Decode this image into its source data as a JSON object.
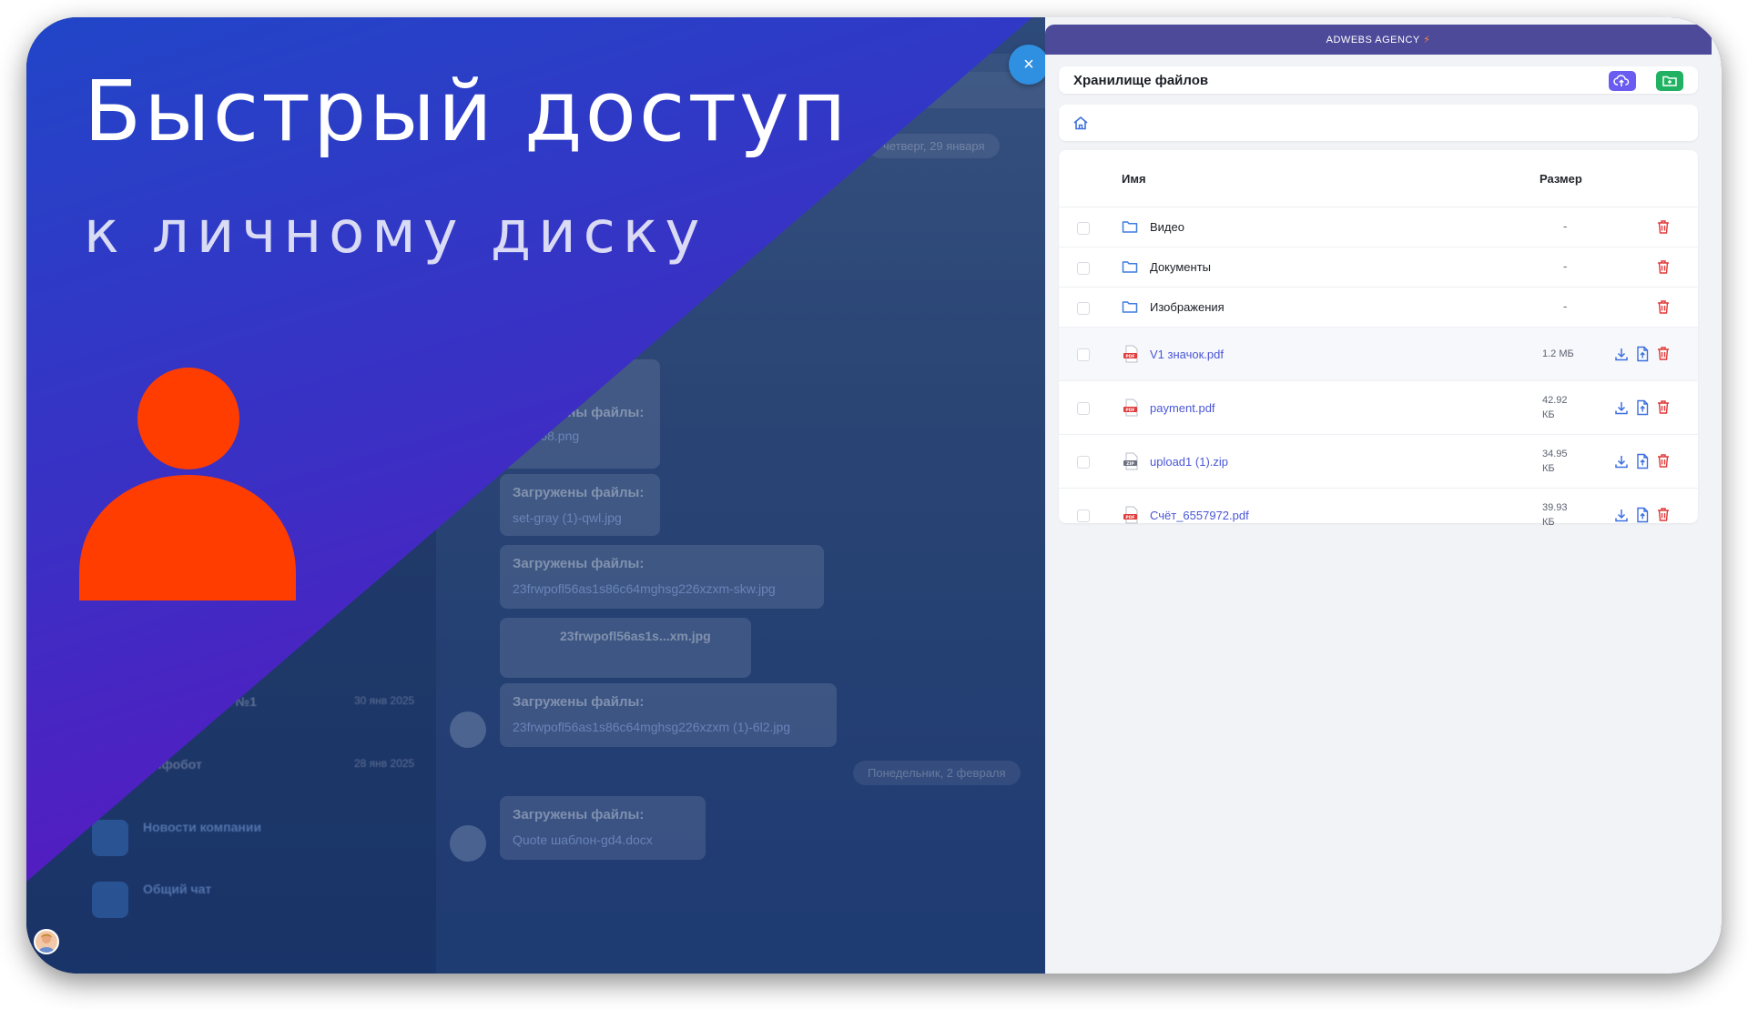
{
  "promo": {
    "title": "Быстрый доступ",
    "subtitle": "к личному диску",
    "accent_color": "#ff3d00",
    "icon": "user-icon"
  },
  "background_chat": {
    "date_pill_1": "четверг, 29 января",
    "date_pill_2": "Понедельник, 2 февраля",
    "uploaded_label": "Загружены файлы:",
    "messages": [
      {
        "title": "Загружены файлы:",
        "file": "ulti-e68.png"
      },
      {
        "title": "Загружены файлы:",
        "file": "set-gray (1)-qwl.jpg"
      },
      {
        "title": "Загружены файлы:",
        "file": "23frwpofl56as1s86c64mghsg226xzxm-skw.jpg"
      },
      {
        "title": "",
        "file": "23frwpofl56as1s...xm.jpg"
      },
      {
        "title": "Загружены файлы:",
        "file": "23frwpofl56as1s86c64mghsg226xzxm (1)-6l2.jpg"
      },
      {
        "title": "Загружены файлы:",
        "file": "Quote шаблон-gd4.docx"
      }
    ],
    "sidebar": [
      {
        "name": "Конференция №1",
        "date": "30 янв 2025"
      },
      {
        "name": "Инфобот",
        "date": "28 янв 2025"
      },
      {
        "name": "Новости компании",
        "date": ""
      },
      {
        "name": "Общий чат",
        "date": ""
      }
    ]
  },
  "panel": {
    "brand": "ADWEBS AGENCY",
    "brand_bolt": "⚡",
    "close_label": "×",
    "title": "Хранилище файлов",
    "columns": {
      "name": "Имя",
      "size": "Размер"
    },
    "folders": [
      {
        "name": "Видео",
        "size": "-"
      },
      {
        "name": "Документы",
        "size": "-"
      },
      {
        "name": "Изображения",
        "size": "-"
      }
    ],
    "files": [
      {
        "name": "V1 значок.pdf",
        "type": "PDF",
        "size_1": "1.2 МБ",
        "size_2": ""
      },
      {
        "name": "payment.pdf",
        "type": "PDF",
        "size_1": "42.92",
        "size_2": "КБ"
      },
      {
        "name": "upload1 (1).zip",
        "type": "ZIP",
        "size_1": "34.95",
        "size_2": "КБ"
      },
      {
        "name": "Счёт_6557972.pdf",
        "type": "PDF",
        "size_1": "39.93",
        "size_2": "КБ"
      }
    ],
    "colors": {
      "brand_bar": "#4d4a9a",
      "upload_button": "#6a5cf0",
      "new_folder_button": "#20b262",
      "file_link": "#4a56d6",
      "folder_icon": "#3d7be0",
      "delete_icon": "#e03a3a",
      "download_icon": "#3d6fe0"
    }
  }
}
